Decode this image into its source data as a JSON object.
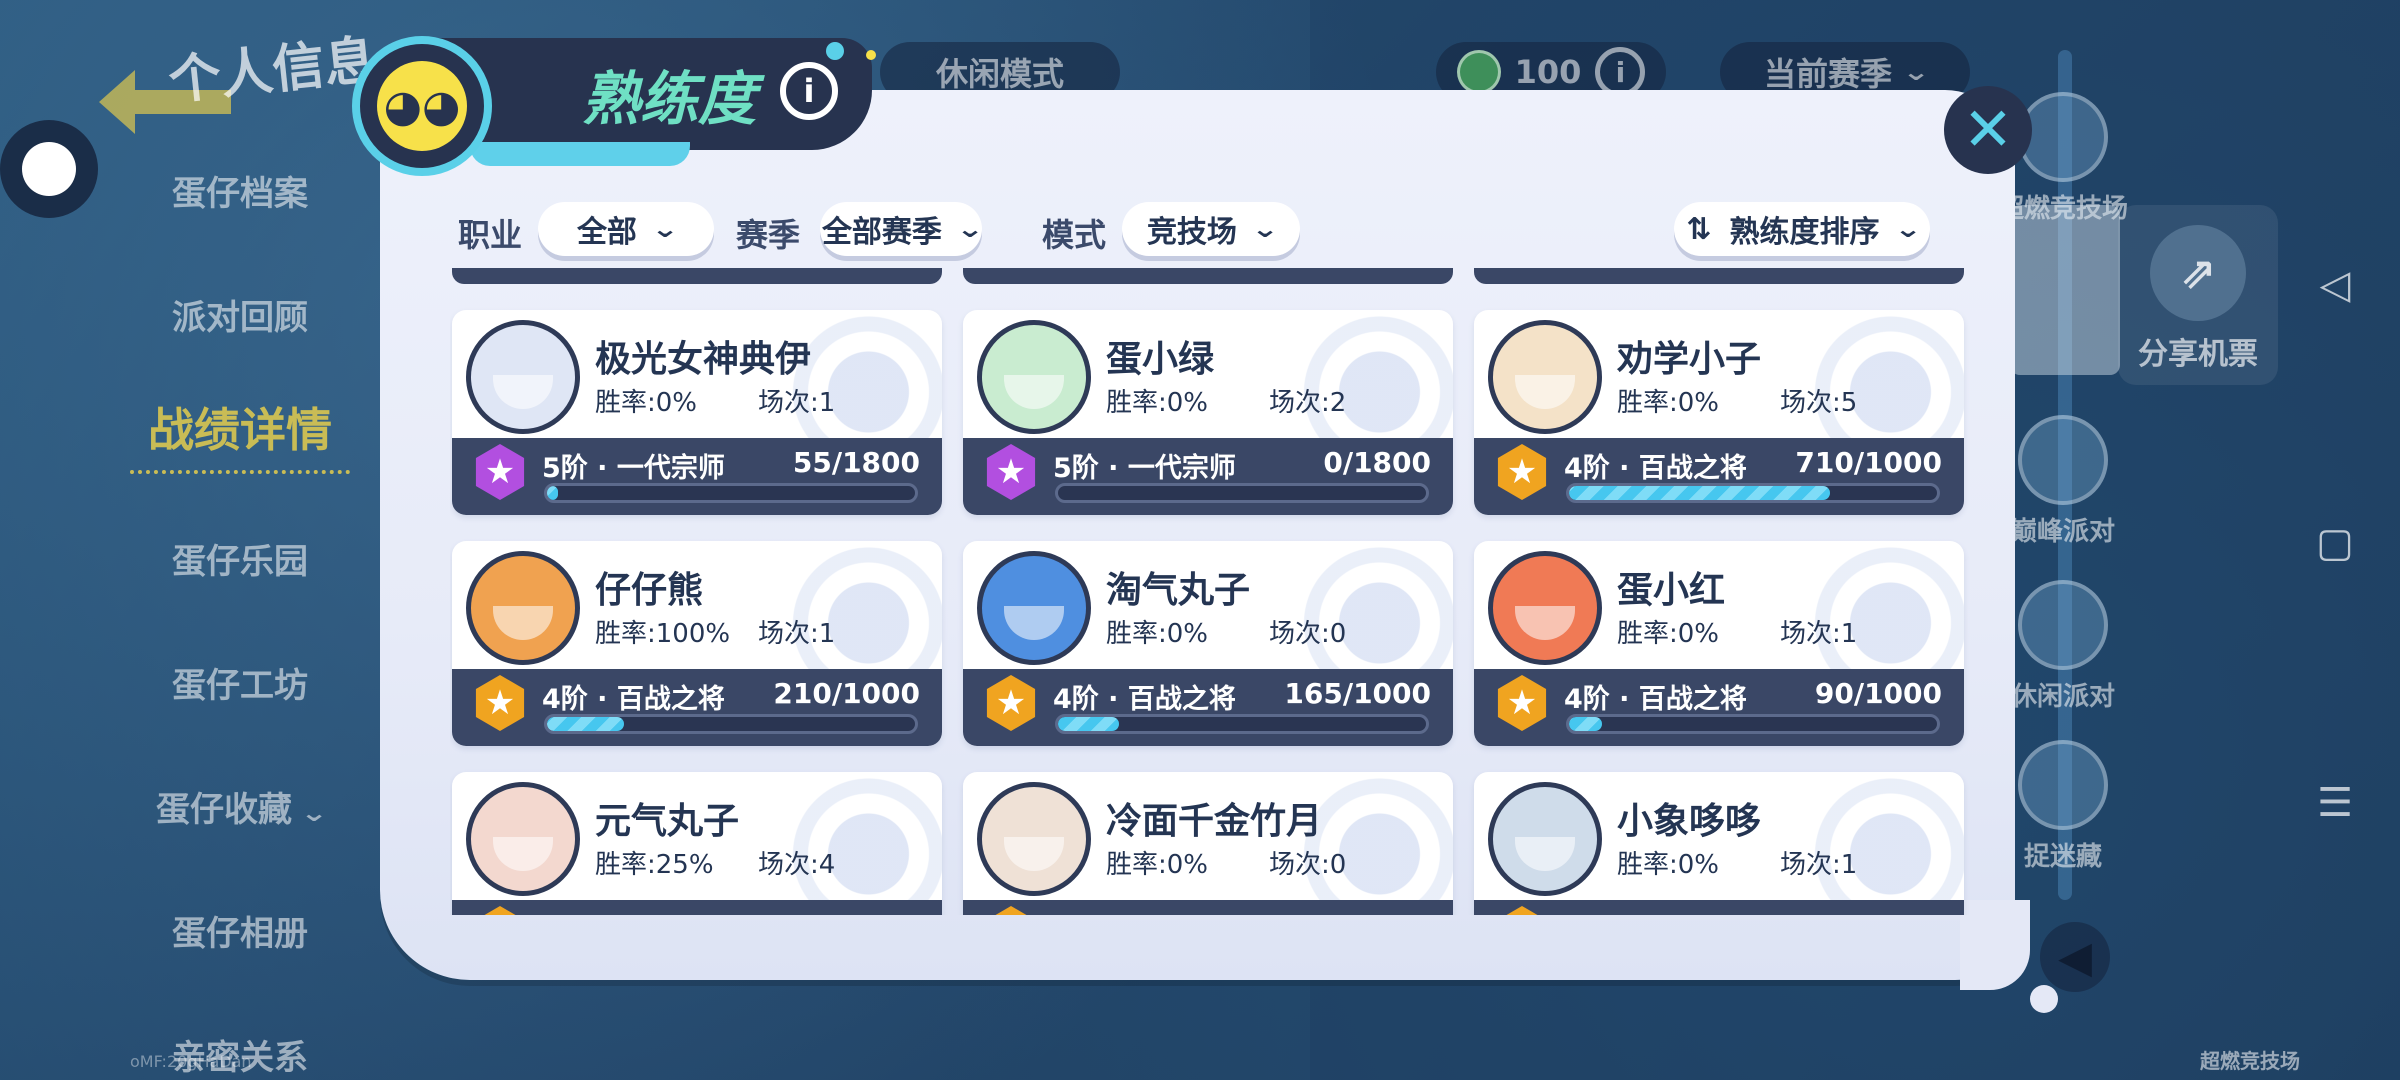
{
  "top_bar": {
    "mode_label": "休闲模式",
    "coin_value": "100",
    "season_dropdown": "当前赛季"
  },
  "left_menu": {
    "title": "个人信息",
    "items": [
      {
        "label": "蛋仔档案"
      },
      {
        "label": "派对回顾"
      },
      {
        "label": "战绩详情",
        "active": true
      },
      {
        "label": "蛋仔乐园"
      },
      {
        "label": "蛋仔工坊"
      },
      {
        "label": "蛋仔收藏"
      },
      {
        "label": "蛋仔相册"
      },
      {
        "label": "亲密关系"
      }
    ]
  },
  "right_rail": {
    "items": [
      {
        "label": "超燃竞技场"
      },
      {
        "label": "巅峰派对"
      },
      {
        "label": "休闲派对"
      },
      {
        "label": "捉迷藏"
      }
    ],
    "share_label": "分享机票",
    "bottom_label": "超燃竞技场"
  },
  "watermark": "oMF:20gHaDan",
  "panel": {
    "title": "熟练度",
    "filters": {
      "job_label": "职业",
      "job_value": "全部",
      "season_label": "赛季",
      "season_value": "全部赛季",
      "mode_label": "模式",
      "mode_value": "竞技场",
      "sort_value": "熟练度排序"
    },
    "cards": [
      {
        "name": "极光女神典伊",
        "winrate": "胜率:0%",
        "games": "场次:1",
        "tier": "5阶 · 一代宗师",
        "exp": "55/1800",
        "progress": 0.031,
        "badge": "purple",
        "avatar_color": "#dfe6f5"
      },
      {
        "name": "蛋小绿",
        "winrate": "胜率:0%",
        "games": "场次:2",
        "tier": "5阶 · 一代宗师",
        "exp": "0/1800",
        "progress": 0.0,
        "badge": "purple",
        "avatar_color": "#c9ecd0"
      },
      {
        "name": "劝学小子",
        "winrate": "胜率:0%",
        "games": "场次:5",
        "tier": "4阶 · 百战之将",
        "exp": "710/1000",
        "progress": 0.71,
        "badge": "gold",
        "avatar_color": "#f4e2c8"
      },
      {
        "name": "仔仔熊",
        "winrate": "胜率:100%",
        "games": "场次:1",
        "tier": "4阶 · 百战之将",
        "exp": "210/1000",
        "progress": 0.21,
        "badge": "gold",
        "avatar_color": "#f0a250"
      },
      {
        "name": "淘气丸子",
        "winrate": "胜率:0%",
        "games": "场次:0",
        "tier": "4阶 · 百战之将",
        "exp": "165/1000",
        "progress": 0.165,
        "badge": "gold",
        "avatar_color": "#4f8fe0"
      },
      {
        "name": "蛋小红",
        "winrate": "胜率:0%",
        "games": "场次:1",
        "tier": "4阶 · 百战之将",
        "exp": "90/1000",
        "progress": 0.09,
        "badge": "gold",
        "avatar_color": "#f07a55"
      },
      {
        "name": "元气丸子",
        "winrate": "胜率:25%",
        "games": "场次:4",
        "tier": "",
        "exp": "",
        "progress": 0.05,
        "badge": "gold",
        "avatar_color": "#f3d8cf"
      },
      {
        "name": "冷面千金竹月",
        "winrate": "胜率:0%",
        "games": "场次:0",
        "tier": "",
        "exp": "",
        "progress": 0.0,
        "badge": "gold",
        "avatar_color": "#efe1d6"
      },
      {
        "name": "小象哆哆",
        "winrate": "胜率:0%",
        "games": "场次:1",
        "tier": "",
        "exp": "",
        "progress": 0.0,
        "badge": "gold",
        "avatar_color": "#cfdcea"
      }
    ]
  },
  "colors": {
    "accent": "#5ad0e8",
    "title": "#6fe0c4",
    "panel": "#eef1fb",
    "card_bar": "#3a4766",
    "gold_badge": "#f0a420",
    "purple_badge": "#b24fe0"
  },
  "icons": {
    "close": "close-icon",
    "info": "info-icon",
    "back": "back-arrow-icon",
    "share": "share-icon",
    "sort": "sort-icon"
  }
}
